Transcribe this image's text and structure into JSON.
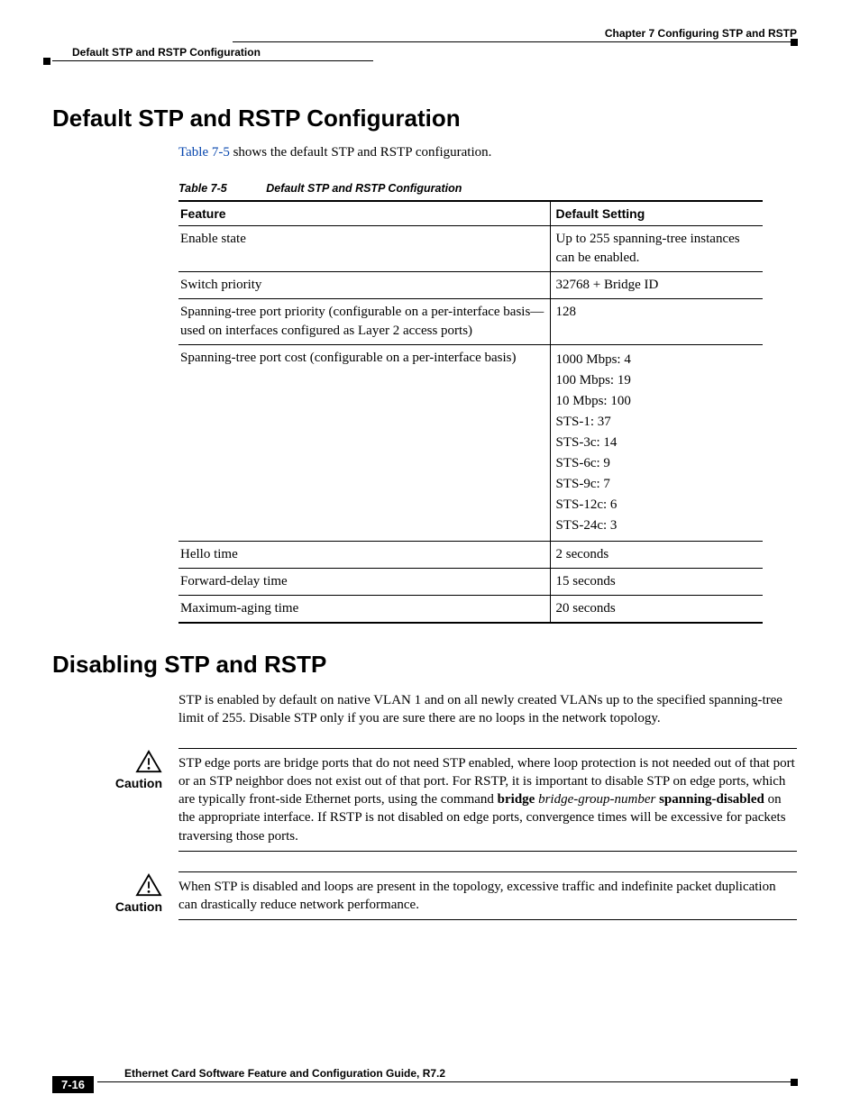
{
  "header": {
    "chapter": "Chapter 7      Configuring STP and RSTP",
    "section": "Default STP and RSTP Configuration"
  },
  "h1a": "Default STP and RSTP Configuration",
  "intro": {
    "xref": "Table 7-5",
    "rest": " shows the default STP and RSTP configuration."
  },
  "table_caption": {
    "label": "Table 7-5",
    "title": "Default STP and RSTP Configuration"
  },
  "table_headers": {
    "feature": "Feature",
    "default": "Default Setting"
  },
  "rows": {
    "r0": {
      "feature": "Enable state",
      "setting": "Up to 255 spanning-tree instances can be enabled."
    },
    "r1": {
      "feature": "Switch priority",
      "setting": "32768 + Bridge ID"
    },
    "r2": {
      "feature": "Spanning-tree port priority (configurable on a per-interface basis—used on interfaces configured as Layer 2 access ports)",
      "setting": "128"
    },
    "r3": {
      "feature": "Spanning-tree port cost (configurable on a per-interface basis)",
      "settings": {
        "s0": "1000 Mbps: 4",
        "s1": "100 Mbps: 19",
        "s2": "10 Mbps: 100",
        "s3": "STS-1: 37",
        "s4": "STS-3c: 14",
        "s5": "STS-6c: 9",
        "s6": "STS-9c: 7",
        "s7": "STS-12c: 6",
        "s8": "STS-24c: 3"
      }
    },
    "r4": {
      "feature": "Hello time",
      "setting": "2 seconds"
    },
    "r5": {
      "feature": "Forward-delay time",
      "setting": "15 seconds"
    },
    "r6": {
      "feature": "Maximum-aging time",
      "setting": "20 seconds"
    }
  },
  "h1b": "Disabling STP and RSTP",
  "p2": "STP is enabled by default on native VLAN 1 and on all newly created VLANs up to the specified spanning-tree limit of 255. Disable STP only if you are sure there are no loops in the network topology.",
  "caution_label": "Caution",
  "caution1": {
    "pre": "STP edge ports are bridge ports that do not need STP enabled, where loop protection is not needed out of that port or an STP neighbor does not exist out of that port. For RSTP, it is important to disable STP on edge ports, which are typically front-side Ethernet ports, using the command ",
    "bold1": "bridge",
    "italic": " bridge-group-number",
    "bold2": " spanning-disabled",
    "post": " on the appropriate interface. If RSTP is not disabled on edge ports, convergence times will be excessive for packets traversing those ports."
  },
  "caution2": "When STP is disabled and loops are present in the topology, excessive traffic and indefinite packet duplication can drastically reduce network performance.",
  "footer": {
    "title": "Ethernet Card Software Feature and Configuration Guide, R7.2",
    "page": "7-16"
  }
}
